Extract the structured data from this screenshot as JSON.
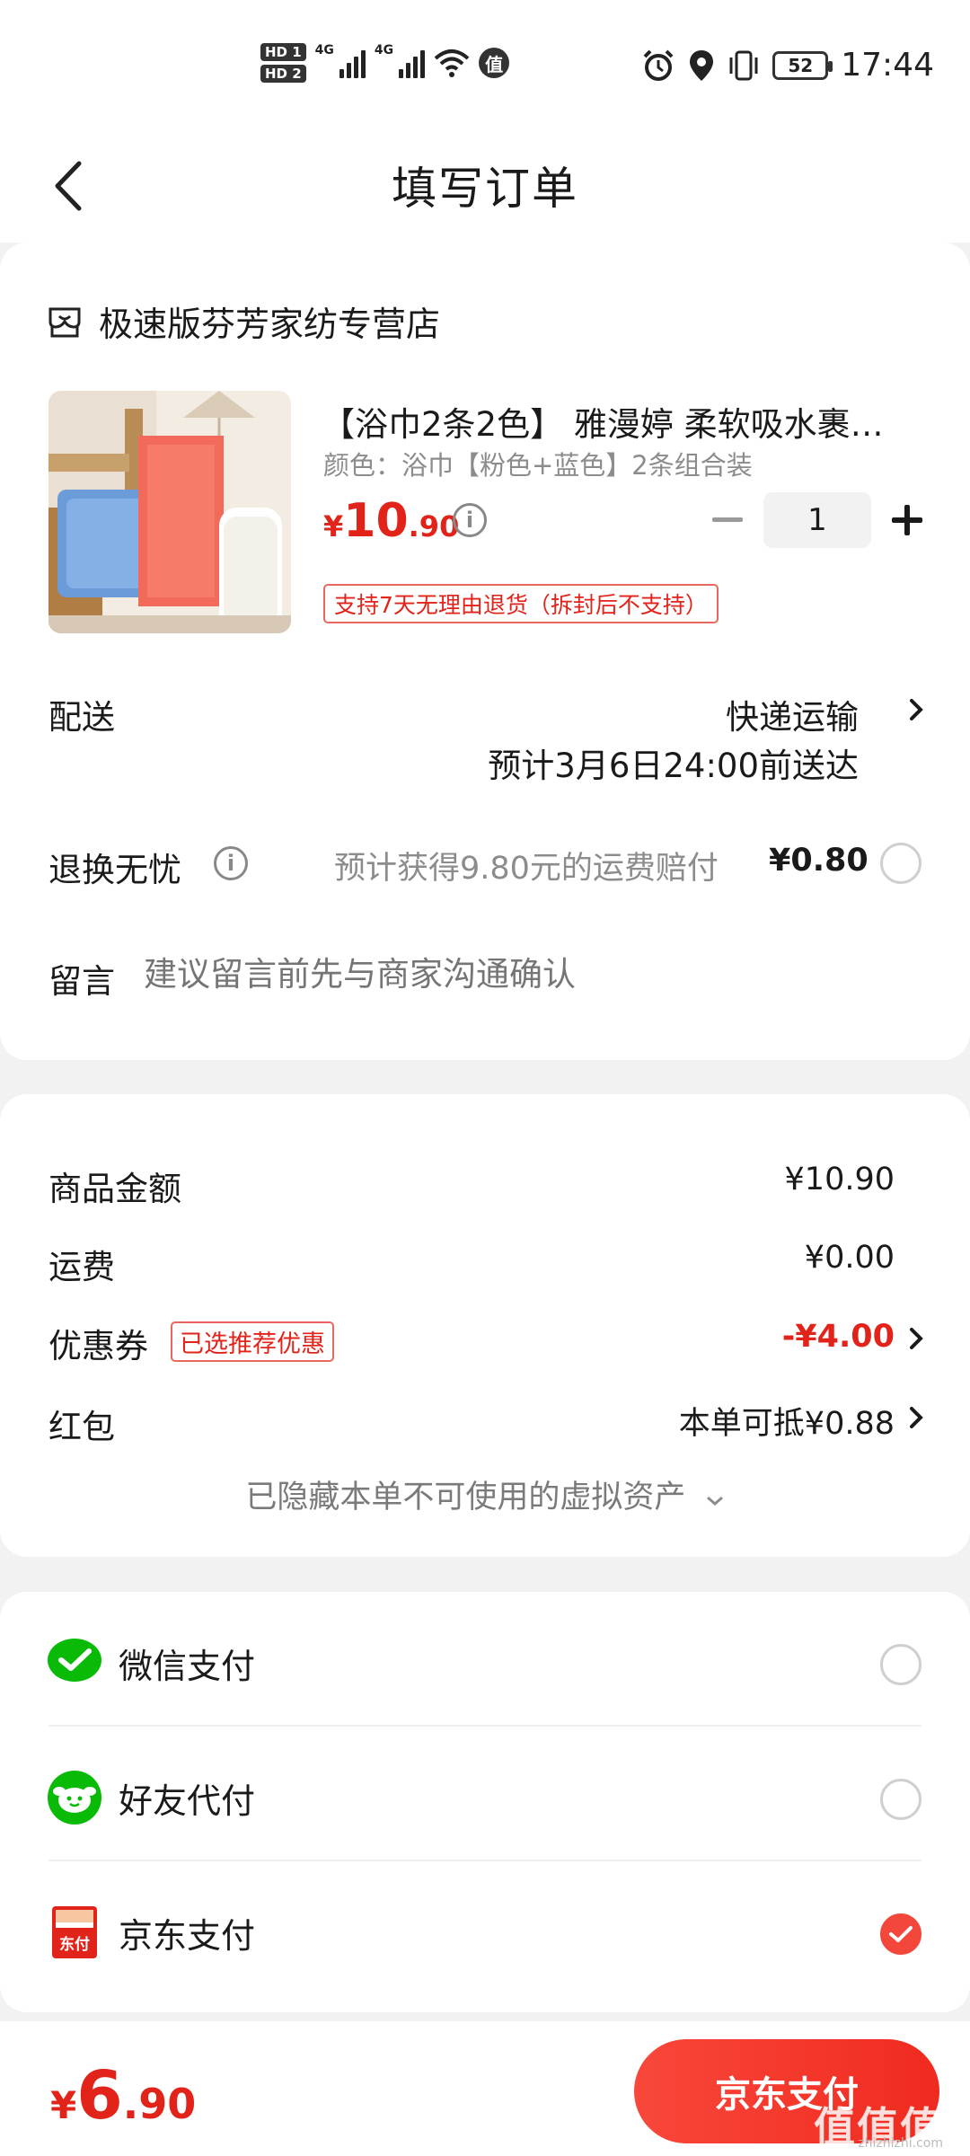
{
  "status_bar": {
    "hd1": "HD 1",
    "hd2": "HD 2",
    "net1": "4G",
    "net2": "4G",
    "app_badge": "值",
    "battery": "52",
    "time": "17:44"
  },
  "header": {
    "title": "填写订单"
  },
  "store": {
    "name": "极速版芬芳家纺专营店"
  },
  "product": {
    "title": "【浴巾2条2色】 雅漫婷 柔软吸水裹…",
    "spec": "颜色：浴巾【粉色+蓝色】2条组合装",
    "price_currency": "¥",
    "price_int": "10",
    "price_dec": ".90",
    "quantity": "1",
    "return_policy": "支持7天无理由退货（拆封后不支持）"
  },
  "delivery": {
    "label": "配送",
    "method": "快递运输",
    "eta": "预计3月6日24:00前送达"
  },
  "return_insurance": {
    "label": "退换无忧",
    "desc": "预计获得9.80元的运费赔付",
    "price": "¥0.80"
  },
  "message": {
    "label": "留言",
    "placeholder": "建议留言前先与商家沟通确认"
  },
  "summary": {
    "goods_label": "商品金额",
    "goods_value": "¥10.90",
    "shipping_label": "运费",
    "shipping_value": "¥0.00",
    "coupon_label": "优惠券",
    "coupon_tag": "已选推荐优惠",
    "coupon_value": "-¥4.00",
    "redpacket_label": "红包",
    "redpacket_value": "本单可抵¥0.88",
    "hidden_assets": "已隐藏本单不可使用的虚拟资产"
  },
  "payment": {
    "options": [
      {
        "label": "微信支付",
        "icon": "wechat-pay-icon",
        "selected": false
      },
      {
        "label": "好友代付",
        "icon": "friend-pay-icon",
        "selected": false
      },
      {
        "label": "京东支付",
        "icon": "jd-pay-icon",
        "selected": true,
        "icon_text": "东付"
      }
    ]
  },
  "bottom": {
    "total_currency": "¥",
    "total_int": "6",
    "total_dec": ".90",
    "pay_button": "京东支付",
    "watermark": "值值值",
    "watermark_sub": "zhizhizhi.com"
  },
  "colors": {
    "accent_red": "#e2231a",
    "wechat_green": "#09bb07",
    "background": "#f2f2f2"
  }
}
